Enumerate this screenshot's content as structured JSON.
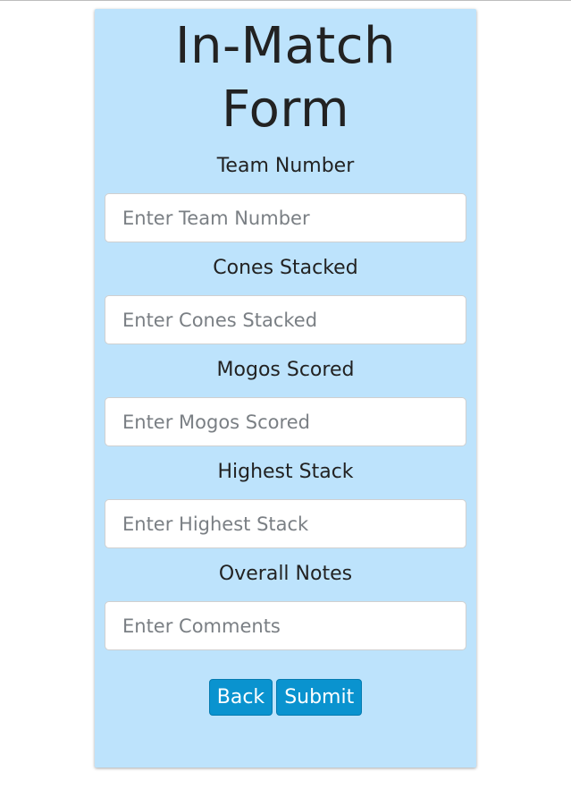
{
  "form": {
    "title": "In-Match Form",
    "fields": [
      {
        "label": "Team Number",
        "placeholder": "Enter Team Number",
        "value": ""
      },
      {
        "label": "Cones Stacked",
        "placeholder": "Enter Cones Stacked",
        "value": ""
      },
      {
        "label": "Mogos Scored",
        "placeholder": "Enter Mogos Scored",
        "value": ""
      },
      {
        "label": "Highest Stack",
        "placeholder": "Enter Highest Stack",
        "value": ""
      },
      {
        "label": "Overall Notes",
        "placeholder": "Enter Comments",
        "value": ""
      }
    ],
    "buttons": {
      "back_label": "Back",
      "submit_label": "Submit"
    }
  },
  "colors": {
    "card_background": "#bde3fc",
    "button_background": "#0a93cf",
    "text": "#222222"
  }
}
